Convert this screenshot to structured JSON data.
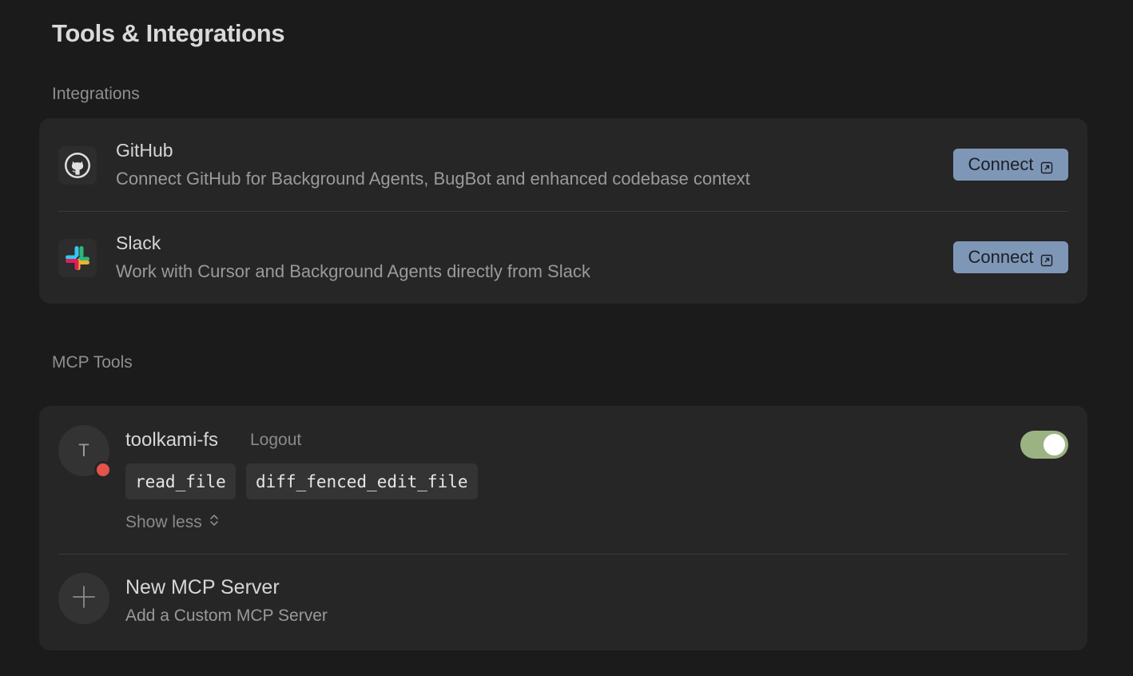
{
  "page": {
    "title": "Tools & Integrations"
  },
  "integrations": {
    "section_label": "Integrations",
    "items": [
      {
        "name": "GitHub",
        "description": "Connect GitHub for Background Agents, BugBot and enhanced codebase context",
        "button_label": "Connect",
        "icon": "github-icon"
      },
      {
        "name": "Slack",
        "description": "Work with Cursor and Background Agents directly from Slack",
        "button_label": "Connect",
        "icon": "slack-icon"
      }
    ]
  },
  "mcp": {
    "section_label": "MCP Tools",
    "server": {
      "avatar_letter": "T",
      "name": "toolkami-fs",
      "logout_label": "Logout",
      "tools": [
        "read_file",
        "diff_fenced_edit_file"
      ],
      "show_less_label": "Show less",
      "enabled": true,
      "status_color": "#e5534b"
    },
    "new_server": {
      "title": "New MCP Server",
      "subtitle": "Add a Custom MCP Server"
    }
  },
  "colors": {
    "background": "#1b1b1b",
    "card": "#262626",
    "connect_button": "#7f97b7",
    "toggle_on": "#9bb383"
  }
}
